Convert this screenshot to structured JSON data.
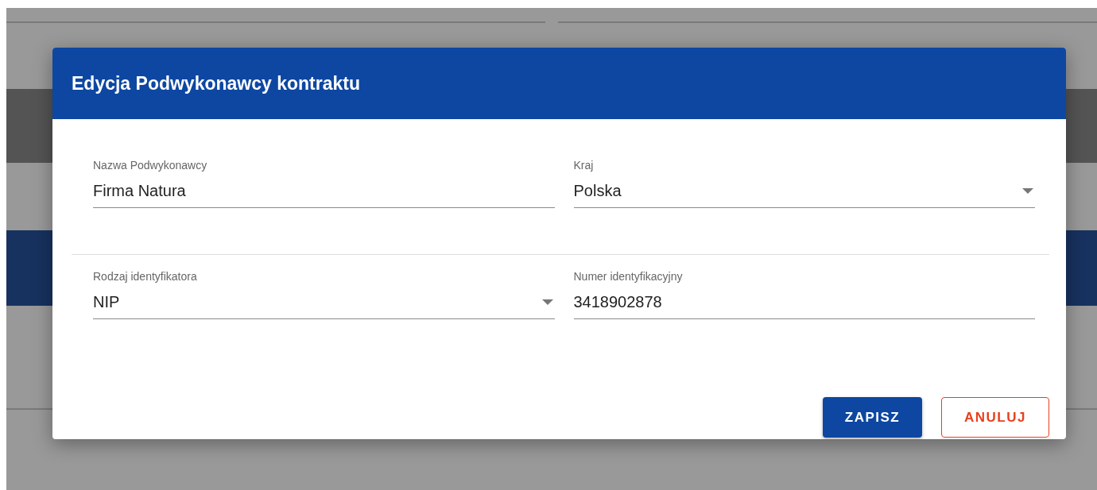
{
  "dialog": {
    "title": "Edycja Podwykonawcy kontraktu",
    "rows": [
      [
        {
          "kind": "text",
          "label": "Nazwa Podwykonawcy",
          "value": "Firma Natura"
        },
        {
          "kind": "select",
          "label": "Kraj",
          "value": "Polska"
        }
      ],
      [
        {
          "kind": "select",
          "label": "Rodzaj identyfikatora",
          "value": "NIP"
        },
        {
          "kind": "text",
          "label": "Numer identyfikacyjny",
          "value": "3418902878"
        }
      ]
    ],
    "buttons": [
      {
        "kind": "primary",
        "label": "ZAPISZ"
      },
      {
        "kind": "outline",
        "label": "ANULUJ"
      }
    ]
  }
}
